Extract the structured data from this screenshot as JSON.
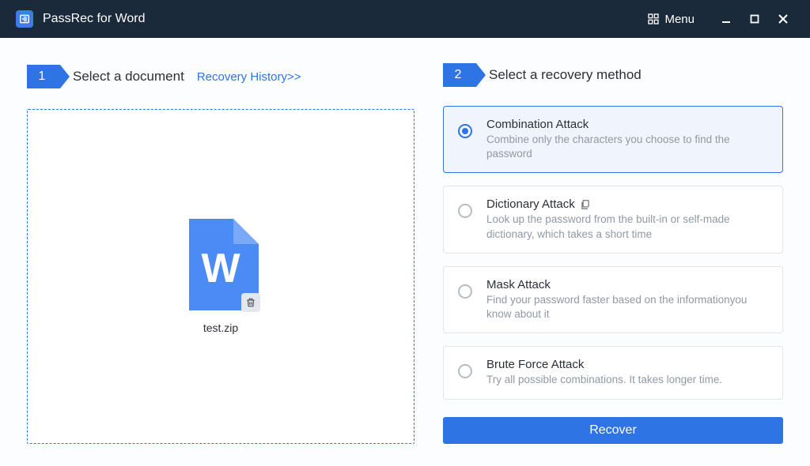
{
  "app": {
    "title": "PassRec for Word",
    "menu_label": "Menu"
  },
  "steps": {
    "select_doc": {
      "num": "1",
      "title": "Select a document",
      "history_link": "Recovery History>>"
    },
    "select_method": {
      "num": "2",
      "title": "Select a recovery method"
    }
  },
  "file": {
    "name": "test.zip"
  },
  "methods": [
    {
      "title": "Combination Attack",
      "desc": "Combine only the characters you choose to find the password",
      "has_icon": false,
      "selected": true
    },
    {
      "title": "Dictionary Attack",
      "desc": "Look up the password from the built-in or self-made dictionary, which takes a short time",
      "has_icon": true,
      "selected": false
    },
    {
      "title": "Mask Attack",
      "desc": "Find your password faster based on the informationyou know about it",
      "has_icon": false,
      "selected": false
    },
    {
      "title": "Brute Force Attack",
      "desc": "Try all possible combinations. It takes longer time.",
      "has_icon": false,
      "selected": false
    }
  ],
  "actions": {
    "recover": "Recover"
  }
}
